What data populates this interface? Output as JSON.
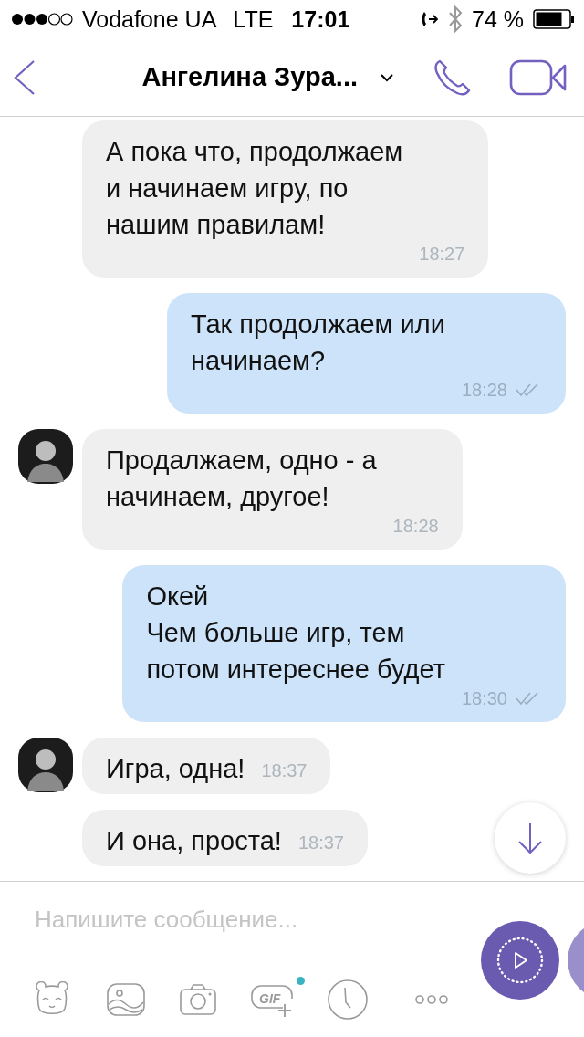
{
  "status_bar": {
    "carrier": "Vodafone UA",
    "network": "LTE",
    "time": "17:01",
    "battery": "74 %"
  },
  "header": {
    "title": "Ангелина Зура..."
  },
  "messages": [
    {
      "kind": "incoming",
      "avatar": false,
      "text": "А пока что, продолжаем\nи начинаем игру, по\nнашим правилам!",
      "time": "18:27"
    },
    {
      "kind": "outgoing",
      "text": "Так продолжаем или\nначинаем?",
      "time": "18:28",
      "delivered": true
    },
    {
      "kind": "incoming",
      "avatar": true,
      "text": "Продалжаем, одно - а\nначинаем, другое!",
      "time": "18:28"
    },
    {
      "kind": "outgoing",
      "text": "Окей\nЧем больше игр, тем\nпотом интереснее будет",
      "time": "18:30",
      "delivered": true
    },
    {
      "kind": "incoming",
      "avatar": true,
      "text": "Игра, одна!",
      "time": "18:37"
    },
    {
      "kind": "incoming",
      "avatar": false,
      "text": "И она, проста!",
      "time": "18:37"
    }
  ],
  "composer": {
    "placeholder": "Напишите сообщение...",
    "gif_label": "GIF",
    "gif_new": true
  }
}
